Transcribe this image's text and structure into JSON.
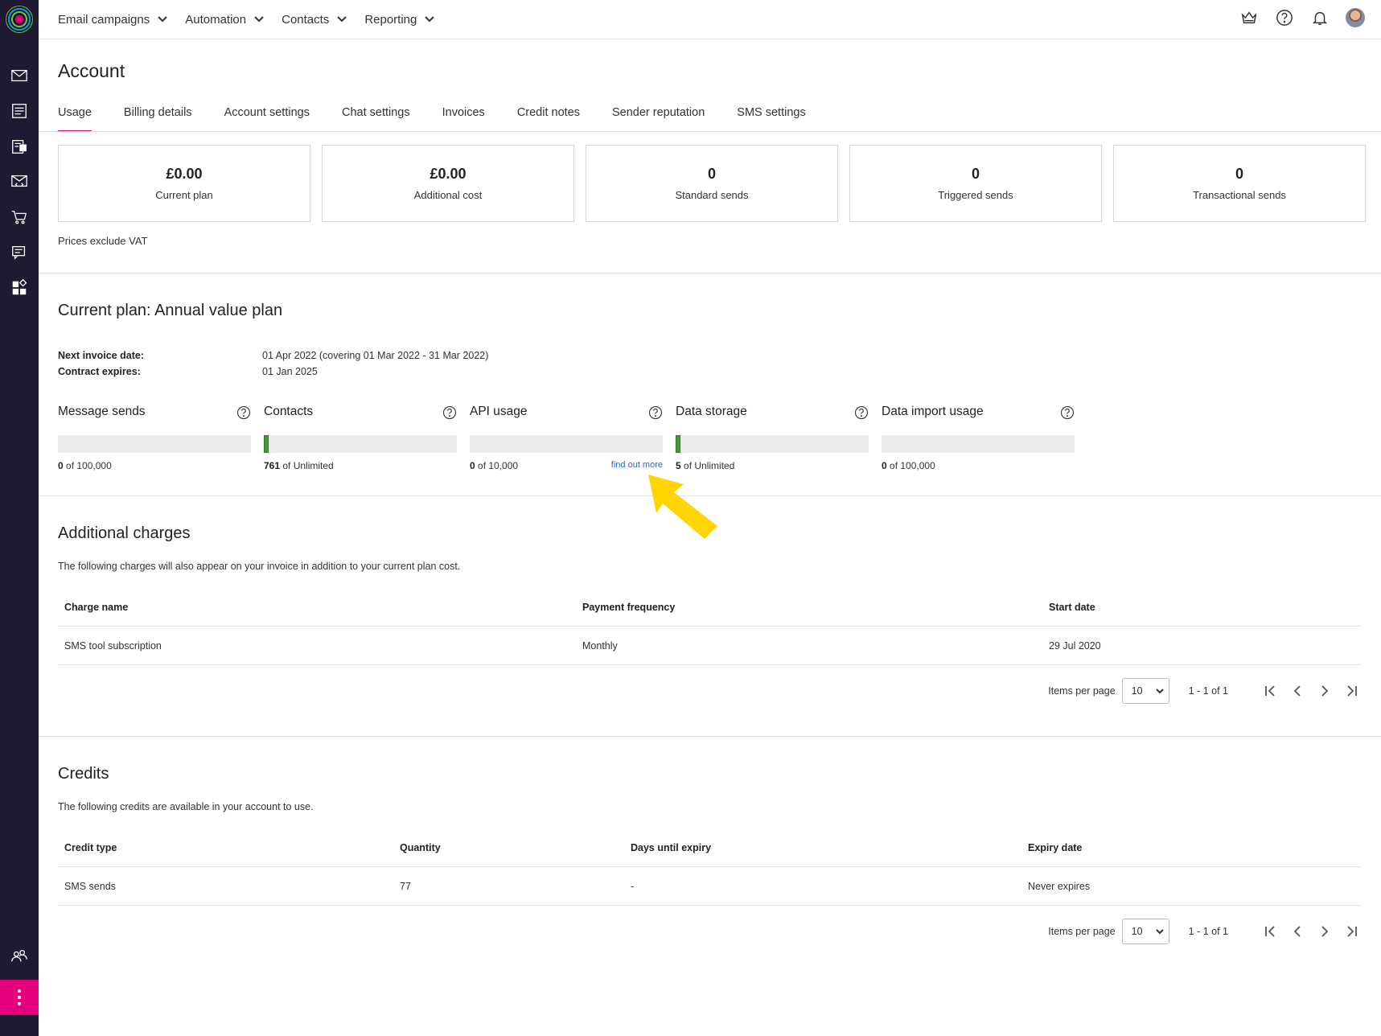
{
  "nav": {
    "items": [
      {
        "label": "Email campaigns"
      },
      {
        "label": "Automation"
      },
      {
        "label": "Contacts"
      },
      {
        "label": "Reporting"
      }
    ],
    "icons": [
      "crown-icon",
      "help-icon",
      "bell-icon",
      "avatar"
    ]
  },
  "sidebar": {
    "icons": [
      "envelope-icon",
      "page-icon",
      "forms-icon",
      "email-code-icon",
      "cart-icon",
      "chat-icon",
      "apps-icon",
      "people-icon",
      "more-icon"
    ]
  },
  "page": {
    "title": "Account",
    "tabs": [
      {
        "label": "Usage",
        "active": true
      },
      {
        "label": "Billing details"
      },
      {
        "label": "Account settings"
      },
      {
        "label": "Chat settings"
      },
      {
        "label": "Invoices"
      },
      {
        "label": "Credit notes"
      },
      {
        "label": "Sender reputation"
      },
      {
        "label": "SMS settings"
      }
    ]
  },
  "summary": {
    "cards": [
      {
        "value": "£0.00",
        "label": "Current plan"
      },
      {
        "value": "£0.00",
        "label": "Additional cost"
      },
      {
        "value": "0",
        "label": "Standard sends"
      },
      {
        "value": "0",
        "label": "Triggered sends"
      },
      {
        "value": "0",
        "label": "Transactional sends"
      }
    ],
    "vat_note": "Prices exclude VAT"
  },
  "plan": {
    "title": "Current plan: Annual value plan",
    "next_invoice_label": "Next invoice date:",
    "next_invoice_value": "01 Apr 2022 (covering 01 Mar 2022 - 31 Mar 2022)",
    "contract_label": "Contract expires:",
    "contract_value": "01 Jan 2025",
    "meters": [
      {
        "name": "Message sends",
        "used": "0",
        "of": "of 100,000",
        "fill_fraction": 0.0
      },
      {
        "name": "Contacts",
        "used": "761",
        "of": "of Unlimited",
        "fill_fraction": 0.02
      },
      {
        "name": "API usage",
        "used": "0",
        "of": "of 10,000",
        "fill_fraction": 0.0,
        "link": "find out more"
      },
      {
        "name": "Data storage",
        "used": "5",
        "of": "of Unlimited",
        "fill_fraction": 0.02
      },
      {
        "name": "Data import usage",
        "used": "0",
        "of": "of 100,000",
        "fill_fraction": 0.0
      }
    ]
  },
  "charges": {
    "title": "Additional charges",
    "description": "The following charges will also appear on your invoice in addition to your current plan cost.",
    "columns": [
      "Charge name",
      "Payment frequency",
      "Start date"
    ],
    "rows": [
      [
        "SMS tool subscription",
        "Monthly",
        "29 Jul 2020"
      ]
    ],
    "pager": {
      "items_per_page_label": "Items per page",
      "page_size": "10",
      "range": "1 - 1 of 1"
    }
  },
  "credits": {
    "title": "Credits",
    "description": "The following credits are available in your account to use.",
    "columns": [
      "Credit type",
      "Quantity",
      "Days until expiry",
      "Expiry date"
    ],
    "rows": [
      [
        "SMS sends",
        "77",
        "-",
        "Never expires"
      ]
    ],
    "pager": {
      "items_per_page_label": "Items per page",
      "page_size": "10",
      "range": "1 - 1 of 1"
    }
  },
  "colors": {
    "accent": "#e4007c",
    "sidebar": "#1e1a32",
    "meter_fill": "#4a9a3a",
    "link": "#1a6dd1",
    "annotation_arrow": "#ffd400"
  }
}
